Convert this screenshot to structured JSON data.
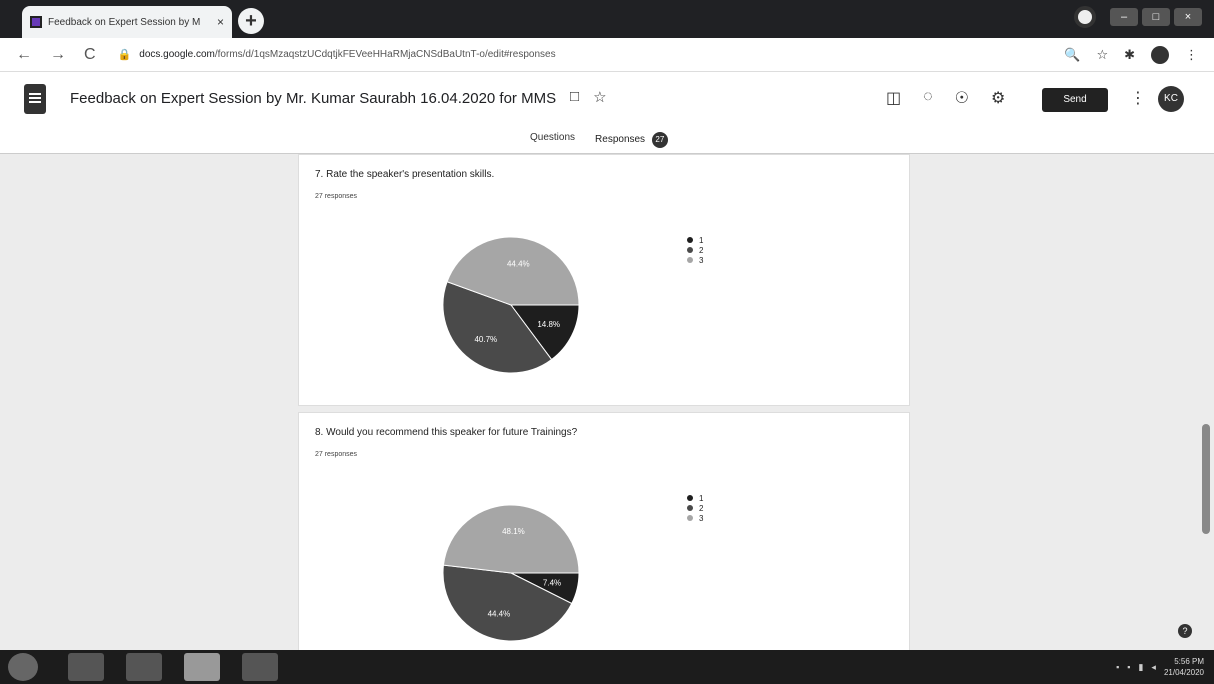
{
  "browser": {
    "tab_title": "Feedback on Expert Session by M",
    "tab_close": "×",
    "new_tab": "+",
    "url_domain": "docs.google.com",
    "url_path": "/forms/d/1qsMzaqstzUCdqtjkFEVeeHHaRMjaCNSdBaUtnT-o/edit#responses"
  },
  "form": {
    "title": "Feedback on Expert Session by Mr. Kumar Saurabh 16.04.2020 for MMS",
    "send_label": "Send",
    "avatar_initials": "KC",
    "tabs": [
      {
        "label": "Questions"
      },
      {
        "label": "Responses",
        "count": "27"
      }
    ]
  },
  "questions": [
    {
      "title": "7. Rate the speaker's presentation skills.",
      "responses": "27 responses"
    },
    {
      "title": "8. Would you recommend this speaker for future Trainings?",
      "responses": "27 responses"
    }
  ],
  "chart_data": [
    {
      "type": "pie",
      "title": "7. Rate the speaker's presentation skills.",
      "categories": [
        "1",
        "2",
        "3"
      ],
      "values": [
        14.8,
        40.7,
        44.4
      ],
      "labels": [
        "14.8%",
        "40.7%",
        "44.4%"
      ],
      "colors": [
        "#1e1e1e",
        "#4a4a4a",
        "#a6a6a6"
      ],
      "legend": "right"
    },
    {
      "type": "pie",
      "title": "8. Would you recommend this speaker for future Trainings?",
      "categories": [
        "1",
        "2",
        "3"
      ],
      "values": [
        7.4,
        44.4,
        48.1
      ],
      "labels": [
        "7.4%",
        "44.4%",
        "48.1%"
      ],
      "colors": [
        "#1e1e1e",
        "#4a4a4a",
        "#a6a6a6"
      ],
      "legend": "right"
    }
  ],
  "taskbar": {
    "time": "5:56 PM",
    "date": "21/04/2020"
  }
}
